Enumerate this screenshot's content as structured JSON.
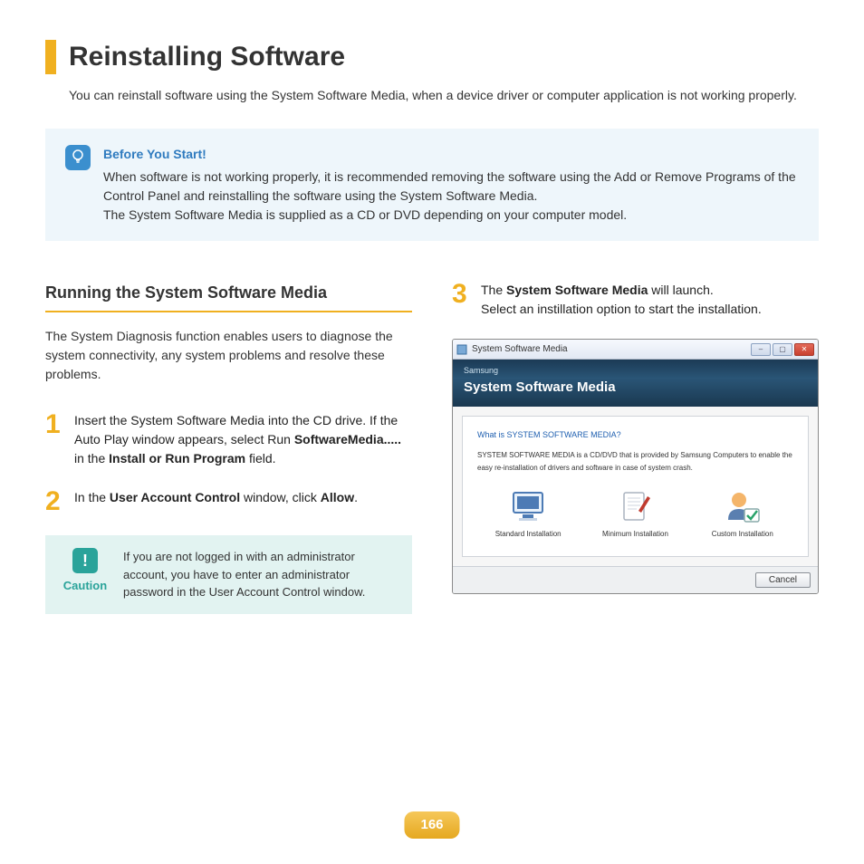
{
  "page": {
    "title": "Reinstalling Software",
    "intro": "You can reinstall software using the System Software Media, when a device driver or computer application is not working properly.",
    "page_number": "166"
  },
  "tip": {
    "heading": "Before You Start!",
    "line1": "When software is not working properly, it is recommended removing the software using the Add or Remove Programs of the Control Panel and reinstalling the software using the System Software Media.",
    "line2": "The System Software Media is supplied as a CD or DVD depending on your computer model."
  },
  "section": {
    "title": "Running the System Software Media",
    "intro": "The System Diagnosis function enables users to diagnose the system connectivity, any system problems and resolve these problems."
  },
  "step1": {
    "num": "1",
    "a": "Insert the System Software Media into the CD drive. If the Auto Play window appears, select Run ",
    "bold1": "SoftwareMedia.....",
    "b": " in the ",
    "bold2": "Install or Run Program",
    "c": " field."
  },
  "step2": {
    "num": "2",
    "a": "In the ",
    "bold1": "User Account Control",
    "b": " window, click ",
    "bold2": "Allow",
    "c": "."
  },
  "step3": {
    "num": "3",
    "a": "The ",
    "bold1": "System Software Media",
    "b": " will launch.",
    "line2": "Select an instillation option to start the installation."
  },
  "caution": {
    "label": "Caution",
    "text": "If you are not logged in with an administrator account, you have to enter an administrator password in the User Account Control window."
  },
  "screenshot": {
    "window_title": "System Software Media",
    "brand": "Samsung",
    "header_title": "System Software Media",
    "question": "What is SYSTEM SOFTWARE MEDIA?",
    "description": "SYSTEM SOFTWARE MEDIA is a CD/DVD that is provided by Samsung Computers to enable the easy re-installation of drivers and software in case of system crash.",
    "options": {
      "standard": "Standard Installation",
      "minimum": "Minimum Installation",
      "custom": "Custom Installation"
    },
    "cancel": "Cancel"
  }
}
